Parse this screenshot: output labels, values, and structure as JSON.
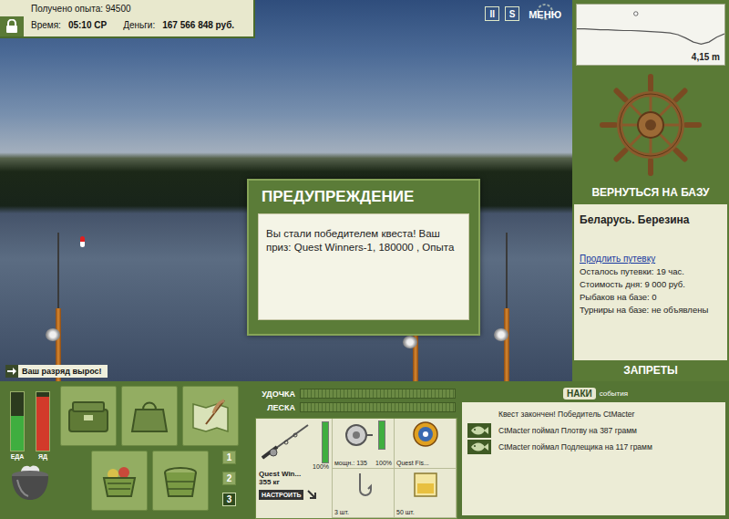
{
  "hud": {
    "experience": "Получено опыта: 94500",
    "time_label": "Время:",
    "time": "05:10 СР",
    "money_label": "Деньги:",
    "money": "167 566 848 руб."
  },
  "top_buttons": [
    {
      "label": "II"
    },
    {
      "label": "S"
    },
    {
      "label": "МЕНЮ"
    }
  ],
  "scene": {
    "rods": [
      {
        "float": true
      },
      {
        "float": false
      },
      {
        "float": false
      }
    ]
  },
  "depth": {
    "reading": "4,15 m",
    "profile": [
      2.3,
      2.3,
      2.35,
      2.4,
      2.4,
      2.45,
      2.5,
      2.5,
      2.55,
      2.6,
      2.65,
      2.7,
      2.8,
      3.0,
      3.4,
      3.9,
      4.15,
      3.9,
      3.3,
      2.9
    ],
    "float": {
      "level": 0.4
    }
  },
  "dialog": {
    "title": "ПРЕДУПРЕЖДЕНИЕ",
    "message": "Вы стали победителем квеста! Ваш приз: Quest Winners-1, 180000 , Опыта"
  },
  "notice": "Ваш разряд вырос!",
  "base": {
    "button": "ВЕРНУТЬСЯ НА БАЗУ",
    "location": "Беларусь. Березина",
    "link": "Продлить путевку",
    "info": [
      "Осталось путевки: 19 час.",
      "Стоимость дня: 9 000 руб.",
      "Рыбаков на базе: 0",
      "Турниры на базе: не объявлены"
    ],
    "bans": "ЗАПРЕТЫ"
  },
  "meters": [
    {
      "label": "ЕДА",
      "level": 0.6,
      "color": "#3fae3f"
    },
    {
      "label": "ЯД",
      "level": 0.92,
      "color": "#d23a2a"
    }
  ],
  "slots": [
    {
      "label": "1",
      "selected": false
    },
    {
      "label": "2",
      "selected": false
    },
    {
      "label": "3",
      "selected": true
    }
  ],
  "tension": [
    {
      "label": "УДОЧКА",
      "level": 0
    },
    {
      "label": "ЛЕСКА",
      "level": 0
    }
  ],
  "tackle": {
    "rod": {
      "name": "Quest Win...",
      "weight": "355 кг",
      "condition": "100%",
      "level": 1,
      "button": "НАСТРОИТЬ"
    },
    "reel": {
      "power": "мощн.: 135",
      "condition": "100%",
      "level": 1
    },
    "line": {
      "name": "Quest Fis..."
    },
    "hook": {
      "count": "3 шт."
    },
    "bait": {
      "count": "50 шт."
    }
  },
  "events": {
    "logo": "НАКИ",
    "tab": "события",
    "items": [
      {
        "text": "Квест закончен! Победитель CtMacter",
        "kind": "system"
      },
      {
        "text": "CtMacter поймал Плотву на 387 грамм",
        "kind": "catch"
      },
      {
        "text": "CtMacter поймал Подлещика на 117 грамм",
        "kind": "catch"
      }
    ]
  }
}
